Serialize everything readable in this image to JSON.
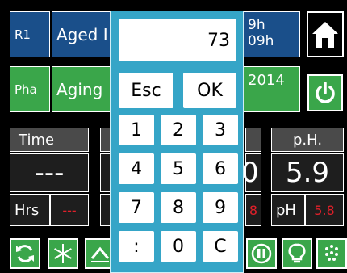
{
  "top": {
    "row1": {
      "id": "R1",
      "name": "Aged I",
      "right_top": "9h",
      "right_bottom": "09h"
    },
    "row2": {
      "id": "Pha",
      "name": "Aging",
      "right": "2014"
    }
  },
  "panels": {
    "time": {
      "title": "Time",
      "value": "---",
      "unit": "Hrs",
      "set": "---"
    },
    "ph": {
      "title": "p.H.",
      "value": "5.9",
      "unit": "pH",
      "set": "5.8"
    },
    "middle_partial_value": "0",
    "middle_partial_set": "8"
  },
  "keypad": {
    "display": "73",
    "esc": "Esc",
    "ok": "OK",
    "keys": [
      "1",
      "2",
      "3",
      "4",
      "5",
      "6",
      "7",
      "8",
      "9",
      ":",
      "0",
      "C"
    ]
  },
  "icons": {
    "home": "home-icon",
    "power": "power-icon",
    "refresh": "refresh-icon",
    "snow": "snowflake-icon",
    "heat": "heat-icon",
    "pause": "pause-icon",
    "bulb": "bulb-icon",
    "drops": "drops-icon"
  },
  "colors": {
    "blue": "#1a4f8a",
    "green": "#3aa64a",
    "keypad": "#35a5c7",
    "red": "#e0202a"
  }
}
